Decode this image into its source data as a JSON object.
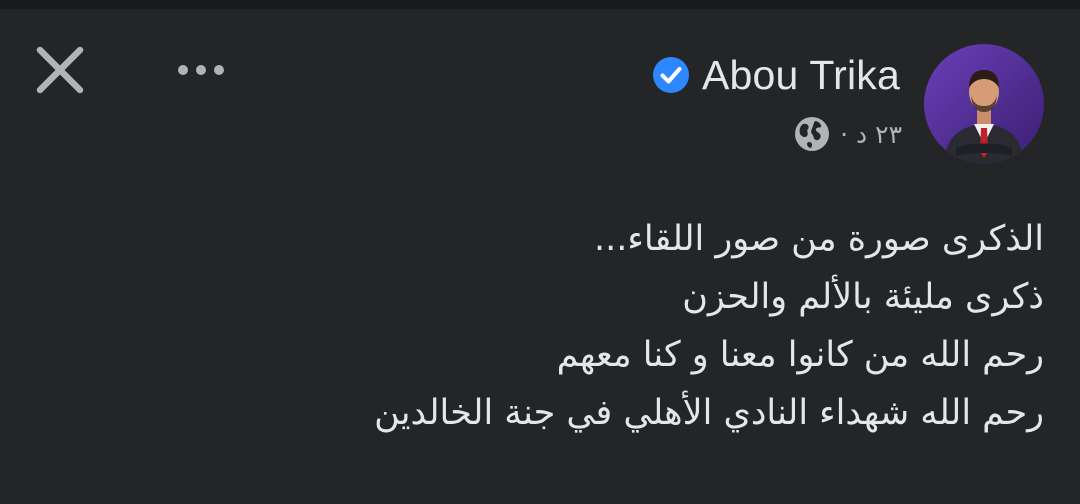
{
  "post": {
    "author": "Abou Trika",
    "time": "٢٣ د ·",
    "privacy_icon": "globe-icon",
    "verified_icon": "verified-badge-icon",
    "lines": [
      "الذكرى صورة من صور اللقاء...",
      "ذكرى مليئة بالألم والحزن",
      "رحم الله من كانوا معنا و كنا معهم",
      "رحم الله شهداء النادي الأهلي في جنة الخالدين"
    ]
  },
  "controls": {
    "close_icon": "close-icon",
    "more_icon": "more-options-icon"
  },
  "colors": {
    "background": "#242526",
    "top_strip": "#18191a",
    "text": "#e4e6eb",
    "secondary_text": "#b0b3b8",
    "verified_blue": "#2d88ff"
  }
}
